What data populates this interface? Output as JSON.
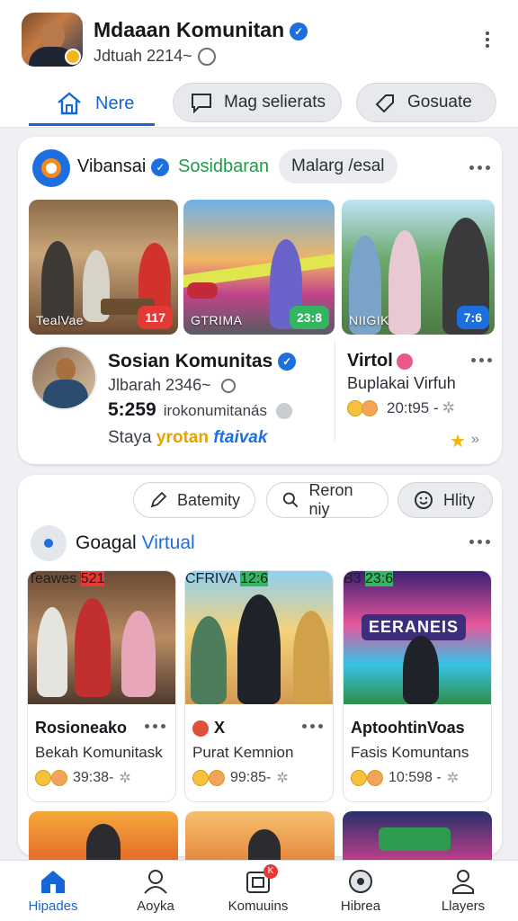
{
  "header": {
    "title": "Mdaaan Komunitan",
    "subtitle": "Jdtuah 2214~",
    "tabs": [
      {
        "label": "Nere",
        "icon": "home-icon",
        "active": true
      },
      {
        "label": "Mag selierats",
        "icon": "message-icon",
        "active": false
      },
      {
        "label": "Gosuate",
        "icon": "tag-icon",
        "active": false
      }
    ]
  },
  "group1": {
    "name": "Vibansai",
    "tag_green": "Sosidbaran",
    "chip": "Malarg /esal",
    "thumbs": [
      {
        "caption": "TealVae",
        "count": "117",
        "color": "#e53935"
      },
      {
        "caption": "GTRIMA",
        "count": "23:8",
        "color": "#33b561"
      },
      {
        "caption": "NIIGIK",
        "count": "7:6",
        "color": "#1d6fe0"
      }
    ],
    "post": {
      "name": "Sosian Komunitas",
      "handle": "Jlbarah 2346~",
      "stat_value": "5:259",
      "stat_text": "irokonumitanás",
      "foot_prefix": "Staya",
      "foot_yellow": "yrotan",
      "foot_blue": "ftaivak"
    },
    "side": {
      "title": "Virtol",
      "subtitle": "Buplakai Virfuh",
      "meta": "20:t95 -"
    }
  },
  "group2": {
    "filters": [
      {
        "label": "Batemity",
        "icon": "pencil-icon"
      },
      {
        "label": "Reron niy",
        "icon": "search-icon"
      },
      {
        "label": "Hlity",
        "icon": "smile-icon"
      }
    ],
    "title_a": "Goagal",
    "title_b": "Virtual",
    "videos": [
      {
        "caption": "Teawes",
        "count": "521",
        "color": "#e53935",
        "name": "Rosioneako",
        "desc": "Bekah Komunitask",
        "meta": "39:38-"
      },
      {
        "caption": "CFRIVA",
        "count": "12:6",
        "color": "#33b561",
        "name": "X",
        "desc": "Purat Kemnion",
        "meta": "99:85-"
      },
      {
        "caption": "B3",
        "count": "23:6",
        "color": "#33b561",
        "name": "AptoohtinVoas",
        "desc": "Fasis Komuntans",
        "meta": "10:598 -",
        "sign": "EERANEIS"
      }
    ]
  },
  "bottom_nav": [
    {
      "label": "Hipades",
      "icon": "home-icon",
      "active": true
    },
    {
      "label": "Aoyka",
      "icon": "people-icon",
      "active": false
    },
    {
      "label": "Komuuins",
      "icon": "community-icon",
      "active": false,
      "badge": "K"
    },
    {
      "label": "Hibrea",
      "icon": "library-icon",
      "active": false
    },
    {
      "label": "Llayers",
      "icon": "profile-icon",
      "active": false
    }
  ]
}
